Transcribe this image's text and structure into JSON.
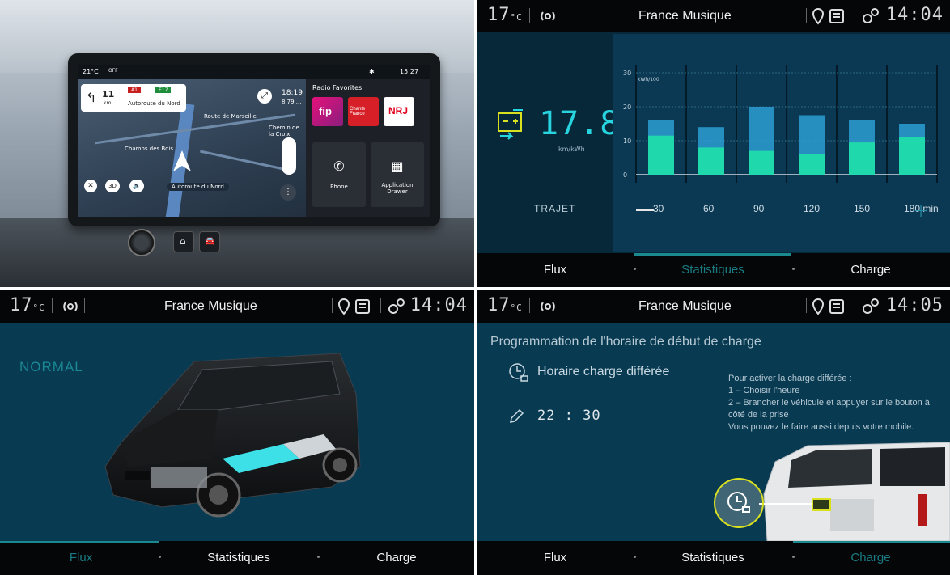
{
  "colors": {
    "accent": "#1a8a90",
    "cyan": "#27d4e0",
    "bar_blue": "#2fa8d8",
    "bar_green": "#1fe0a8",
    "highlight_yellow": "#d8e020",
    "status_bar": "#050608",
    "screen_bg": "#083a52"
  },
  "console": {
    "status_temp": "21°C",
    "status_off": "OFF",
    "status_time": "15:27",
    "nav_distance": "11",
    "nav_unit": "km",
    "nav_road": "Autoroute du Nord",
    "nav_badge1": "A1",
    "nav_badge2": "E17",
    "map_labels": [
      "Route de Marseille",
      "Champs des Bois",
      "Chemin de la Croix"
    ],
    "eta_time": "18:19",
    "eta_dist": "8.79 ...",
    "mode_3d": "3D",
    "bottom_road": "Autoroute du Nord",
    "fav_title": "Radio Favorites",
    "stations": [
      "fip",
      "Chante France",
      "NRJ"
    ],
    "phone_label": "Phone",
    "app_drawer_label": "Application Drawer"
  },
  "statusbar": {
    "temp_value": "17",
    "temp_unit": "°C",
    "station": "France Musique",
    "time_q2": "14:04",
    "time_q3": "14:04",
    "time_q4": "14:05",
    "location_icon": "map-pin-icon",
    "media_icon": "media-list-icon",
    "settings_icon": "gear-icon",
    "radio_icon": "radio-signal-icon"
  },
  "tabs": {
    "flux": "Flux",
    "statistiques": "Statistiques",
    "charge": "Charge",
    "active_q2": "Statistiques",
    "active_q3": "Flux",
    "active_q4": "Charge"
  },
  "stats": {
    "efficiency_value": "17.8",
    "efficiency_unit": "km/kWh",
    "ylabel": "kWh/100",
    "trajet_label": "TRAJET",
    "xtick_unit_suffix": "min"
  },
  "chart_data": {
    "type": "bar",
    "title": "",
    "ylabel": "kWh/100",
    "xlabel": "",
    "ylim": [
      0,
      30
    ],
    "yticks": [
      0,
      10,
      20,
      30
    ],
    "categories": [
      "30",
      "60",
      "90",
      "120",
      "150",
      "180 min"
    ],
    "series": [
      {
        "values": [
          16,
          14,
          20,
          17.5,
          16,
          15
        ]
      },
      {
        "values": [
          11.5,
          8,
          7,
          6,
          9.5,
          11
        ]
      }
    ],
    "grid": true,
    "legend": "none"
  },
  "flux": {
    "mode": "NORMAL"
  },
  "charge": {
    "title": "Programmation de l'horaire de début de charge",
    "deferred_label": "Horaire charge différée",
    "time_value": "22 : 30",
    "instructions": [
      "Pour activer la charge différée :",
      "1 – Choisir l'heure",
      "2 – Brancher le véhicule et appuyer sur le bouton à côté de la prise",
      "Vous pouvez le faire aussi depuis votre mobile."
    ]
  }
}
